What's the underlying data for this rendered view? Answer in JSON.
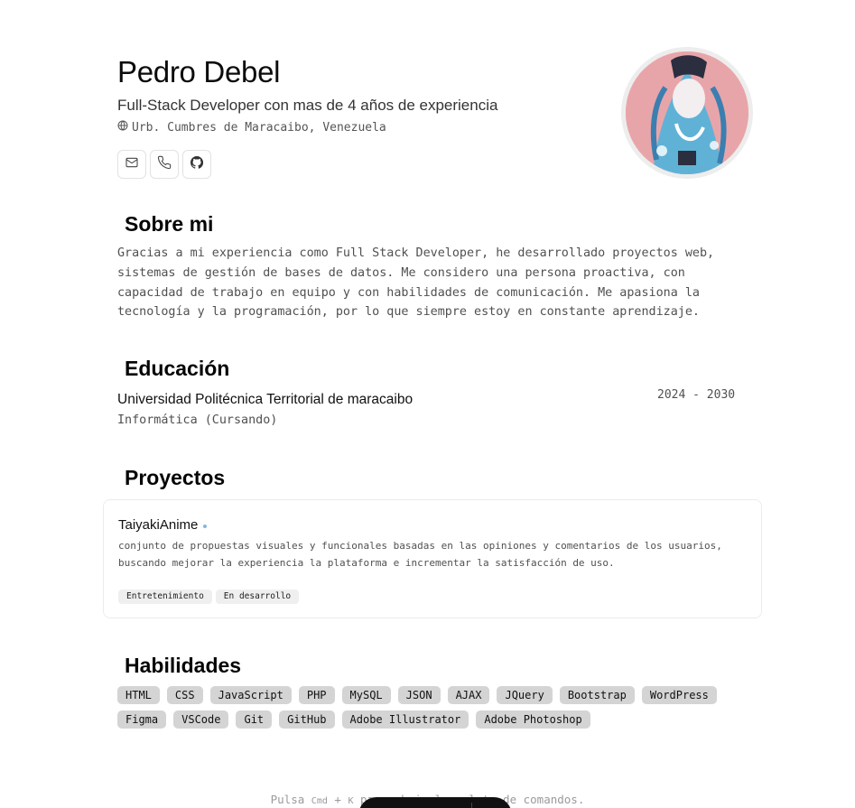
{
  "profile": {
    "name": "Pedro Debel",
    "headline": "Full-Stack Developer con mas de 4 años de experiencia",
    "location": "Urb. Cumbres de Maracaibo, Venezuela",
    "contacts": [
      {
        "icon": "mail-icon"
      },
      {
        "icon": "phone-icon"
      },
      {
        "icon": "github-icon"
      }
    ],
    "avatar_alt": "avatar"
  },
  "about": {
    "title": "Sobre mi",
    "text": "Gracias a mi experiencia como Full Stack Developer, he desarrollado proyectos web, sistemas de gestión de bases de datos. Me considero una persona proactiva, con capacidad de trabajo en equipo y con habilidades de comunicación. Me apasiona la tecnología y la programación, por lo que siempre estoy en constante aprendizaje."
  },
  "education": {
    "title": "Educación",
    "school": "Universidad Politécnica Territorial de maracaibo",
    "degree": "Informática (Cursando)",
    "dates": "2024 - 2030"
  },
  "projects": {
    "title": "Proyectos",
    "items": [
      {
        "name": "TaiyakiAnime",
        "description": "conjunto de propuestas visuales y funcionales basadas en las opiniones y comentarios de los usuarios, buscando mejorar la experiencia la plataforma e incrementar la satisfacción de uso.",
        "tags": [
          "Entretenimiento",
          "En desarrollo"
        ]
      }
    ]
  },
  "skills": {
    "title": "Habilidades",
    "items": [
      "HTML",
      "CSS",
      "JavaScript",
      "PHP",
      "MySQL",
      "JSON",
      "AJAX",
      "JQuery",
      "Bootstrap",
      "WordPress",
      "Figma",
      "VSCode",
      "Git",
      "GitHub",
      "Adobe Illustrator",
      "Adobe Photoshop"
    ]
  },
  "footer": {
    "hint_prefix": "Pulsa",
    "hint_key1": "Cmd",
    "hint_plus": "+",
    "hint_key2": "K",
    "hint_suffix": "para abrir la paleta de comandos."
  },
  "colors": {
    "tag_bg": "#d4d4d4",
    "small_tag_bg": "#efefef",
    "status_dot": "#86b6d9",
    "avatar_bg": "#e8a5a9"
  }
}
